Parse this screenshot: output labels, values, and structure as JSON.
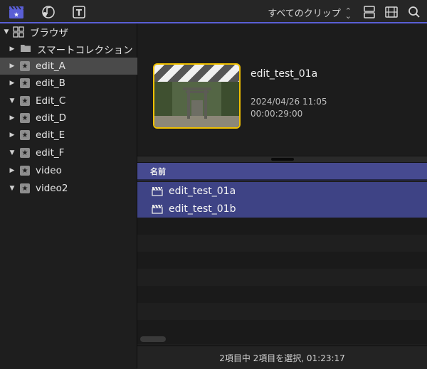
{
  "toolbar": {
    "filter_label": "すべてのクリップ",
    "accent": "#5a5fd6",
    "icons": [
      "libraries-icon",
      "photos-audio-icon",
      "titles-generators-icon",
      "clip-appearance-icon",
      "filmstrip-icon",
      "search-icon"
    ]
  },
  "sidebar": {
    "browser_label": "ブラウザ",
    "smart_collections_label": "スマートコレクション",
    "libraries": [
      {
        "label": "edit_A",
        "expanded": false,
        "selected": true
      },
      {
        "label": "edit_B",
        "expanded": false,
        "selected": false
      },
      {
        "label": "Edit_C",
        "expanded": true,
        "selected": false
      },
      {
        "label": "edit_D",
        "expanded": false,
        "selected": false
      },
      {
        "label": "edit_E",
        "expanded": false,
        "selected": false
      },
      {
        "label": "edit_F",
        "expanded": true,
        "selected": false
      },
      {
        "label": "video",
        "expanded": false,
        "selected": false
      },
      {
        "label": "video2",
        "expanded": true,
        "selected": false
      }
    ]
  },
  "viewer": {
    "clip_name": "edit_test_01a",
    "date": "2024/04/26 11:05",
    "duration": "00:00:29:00"
  },
  "list": {
    "column_name": "名前",
    "rows": [
      {
        "name": "edit_test_01a"
      },
      {
        "name": "edit_test_01b"
      }
    ]
  },
  "footer": {
    "status": "2項目中 2項目を選択, 01:23:17"
  },
  "colors": {
    "selection": "#3e4385",
    "header": "#464a90",
    "thumb_border": "#f0c000"
  }
}
